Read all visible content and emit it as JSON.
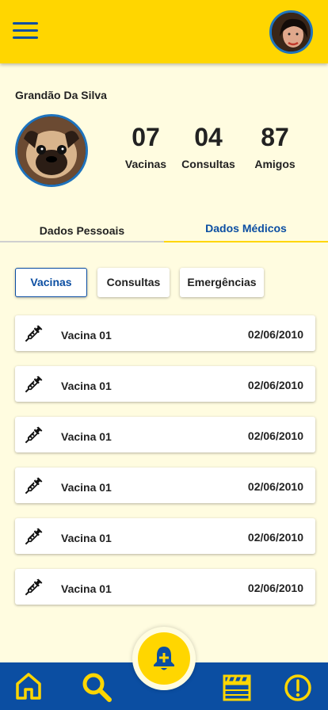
{
  "profile": {
    "owner_name": "Grandão Da Silva",
    "stats": [
      {
        "value": "07",
        "label": "Vacinas"
      },
      {
        "value": "04",
        "label": "Consultas"
      },
      {
        "value": "87",
        "label": "Amigos"
      }
    ]
  },
  "tabs": [
    {
      "label": "Dados Pessoais",
      "active": false
    },
    {
      "label": "Dados Médicos",
      "active": true
    }
  ],
  "filters": [
    {
      "label": "Vacinas",
      "selected": true
    },
    {
      "label": "Consultas",
      "selected": false
    },
    {
      "label": "Emergências",
      "selected": false
    }
  ],
  "vaccines": [
    {
      "name": "Vacina 01",
      "date": "02/06/2010"
    },
    {
      "name": "Vacina 01",
      "date": "02/06/2010"
    },
    {
      "name": "Vacina 01",
      "date": "02/06/2010"
    },
    {
      "name": "Vacina 01",
      "date": "02/06/2010"
    },
    {
      "name": "Vacina 01",
      "date": "02/06/2010"
    },
    {
      "name": "Vacina 01",
      "date": "02/06/2010"
    }
  ],
  "bottom_nav": {
    "items": [
      "home-icon",
      "search-icon",
      "add-alert-icon",
      "clapperboard-icon",
      "alert-circle-icon"
    ]
  },
  "colors": {
    "primary_yellow": "#FFD600",
    "primary_blue": "#0B4EA2",
    "background": "#FFFCE0"
  }
}
